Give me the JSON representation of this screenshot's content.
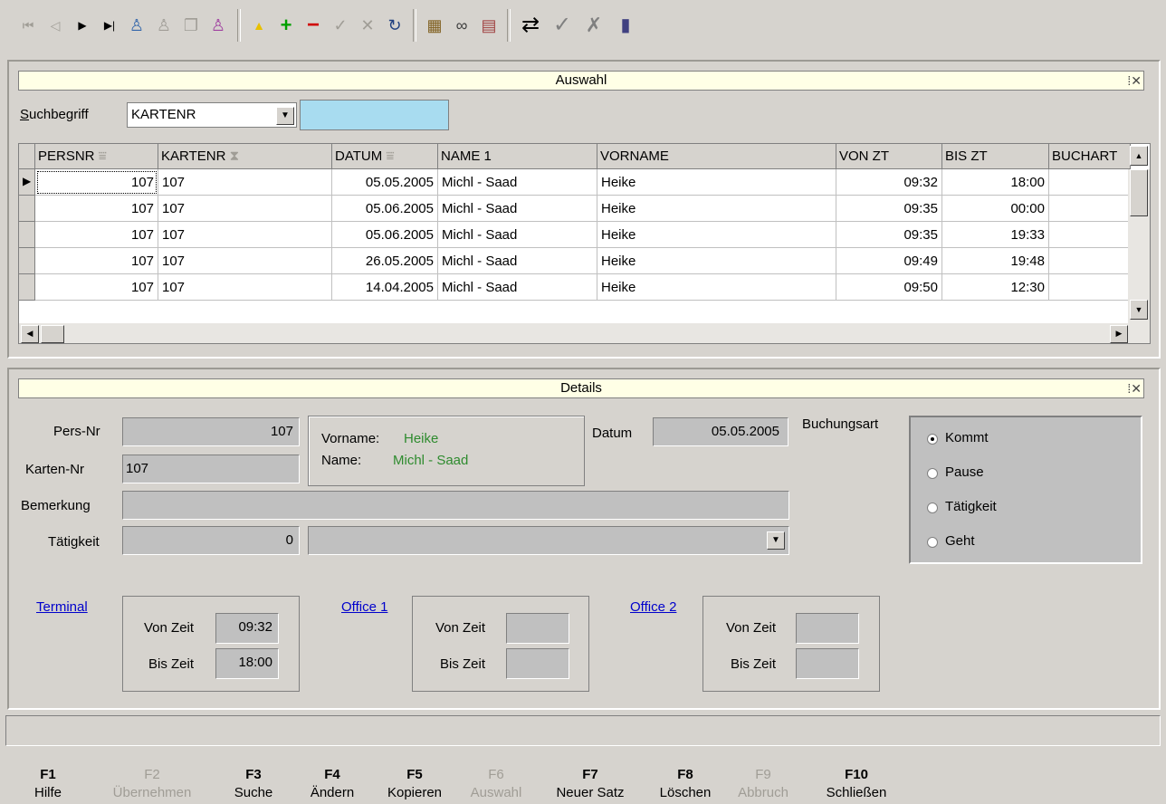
{
  "toolbar": {
    "icons": [
      "first-record-icon",
      "prev-record-icon",
      "next-record-icon",
      "last-record-icon",
      "bell-icon",
      "bell-x-icon",
      "copy-doc-icon",
      "bell-pink-icon",
      "up-triangle-icon",
      "plus-icon",
      "minus-icon",
      "check-grey-icon",
      "x-grey-icon",
      "refresh-icon",
      "table-icon",
      "binoculars-icon",
      "export-icon",
      "swap-arrows-icon",
      "check-icon",
      "cancel-icon",
      "exit-door-icon"
    ]
  },
  "auswahl": {
    "title": "Auswahl",
    "search_label": "Suchbegriff",
    "search_field": "KARTENR",
    "search_value": ""
  },
  "grid": {
    "columns": [
      "PERSNR",
      "KARTENR",
      "DATUM",
      "NAME 1",
      "VORNAME",
      "VON ZT",
      "BIS ZT",
      "BUCHART"
    ],
    "rows": [
      [
        "107",
        "107",
        "05.05.2005",
        "Michl - Saad",
        "Heike",
        "09:32",
        "18:00",
        ""
      ],
      [
        "107",
        "107",
        "05.06.2005",
        "Michl - Saad",
        "Heike",
        "09:35",
        "00:00",
        ""
      ],
      [
        "107",
        "107",
        "05.06.2005",
        "Michl - Saad",
        "Heike",
        "09:35",
        "19:33",
        ""
      ],
      [
        "107",
        "107",
        "26.05.2005",
        "Michl - Saad",
        "Heike",
        "09:49",
        "19:48",
        ""
      ],
      [
        "107",
        "107",
        "14.04.2005",
        "Michl - Saad",
        "Heike",
        "09:50",
        "12:30",
        ""
      ]
    ]
  },
  "details": {
    "title": "Details",
    "pers_nr_label": "Pers-Nr",
    "pers_nr": "107",
    "karten_nr_label": "Karten-Nr",
    "karten_nr": "107",
    "vorname_label": "Vorname:",
    "vorname": "Heike",
    "name_label": "Name:",
    "name": "Michl - Saad",
    "datum_label": "Datum",
    "datum": "05.05.2005",
    "buchungsart_label": "Buchungsart",
    "buchungsart_options": [
      "Kommt",
      "Pause",
      "Tätigkeit",
      "Geht"
    ],
    "buchungsart_selected": "Kommt",
    "bemerkung_label": "Bemerkung",
    "bemerkung": "",
    "taetigkeit_label": "Tätigkeit",
    "taetigkeit_nr": "0",
    "taetigkeit_text": "",
    "terminal": {
      "link": "Terminal",
      "von_label": "Von Zeit",
      "von": "09:32",
      "bis_label": "Bis Zeit",
      "bis": "18:00"
    },
    "office1": {
      "link": "Office 1",
      "von_label": "Von Zeit",
      "von": "",
      "bis_label": "Bis Zeit",
      "bis": ""
    },
    "office2": {
      "link": "Office 2",
      "von_label": "Von Zeit",
      "von": "",
      "bis_label": "Bis Zeit",
      "bis": ""
    }
  },
  "fkeys": [
    {
      "key": "F1",
      "label": "Hilfe",
      "enabled": true
    },
    {
      "key": "F2",
      "label": "Übernehmen",
      "enabled": false
    },
    {
      "key": "F3",
      "label": "Suche",
      "enabled": true
    },
    {
      "key": "F4",
      "label": "Ändern",
      "enabled": true
    },
    {
      "key": "F5",
      "label": "Kopieren",
      "enabled": true
    },
    {
      "key": "F6",
      "label": "Auswahl",
      "enabled": false
    },
    {
      "key": "F7",
      "label": "Neuer Satz",
      "enabled": true
    },
    {
      "key": "F8",
      "label": "Löschen",
      "enabled": true
    },
    {
      "key": "F9",
      "label": "Abbruch",
      "enabled": false
    },
    {
      "key": "F10",
      "label": "Schließen",
      "enabled": true
    }
  ],
  "colors": {
    "title_bg": "#ffffe6",
    "selection_bg": "#a8dcf0",
    "link": "#0000cc",
    "value_green": "#2e8b2e"
  }
}
